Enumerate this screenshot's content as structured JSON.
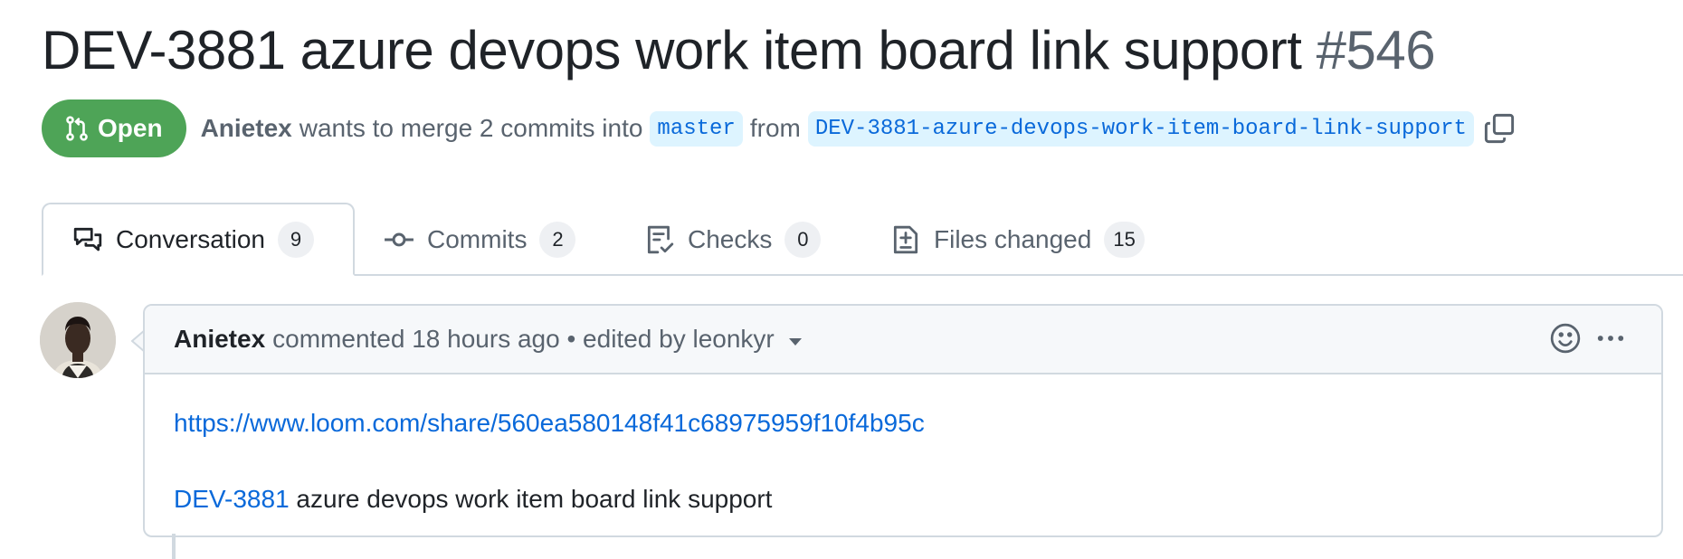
{
  "pr": {
    "title": "DEV-3881 azure devops work item board link support",
    "number": "#546",
    "state": "Open",
    "author": "Anietex",
    "merge_text": "wants to merge 2 commits into",
    "base_branch": "master",
    "from_text": "from",
    "head_branch": "DEV-3881-azure-devops-work-item-board-link-support",
    "state_color": "#4ea457"
  },
  "tabs": [
    {
      "label": "Conversation",
      "count": "9",
      "icon": "comment-discussion-icon"
    },
    {
      "label": "Commits",
      "count": "2",
      "icon": "git-commit-icon"
    },
    {
      "label": "Checks",
      "count": "0",
      "icon": "checklist-icon"
    },
    {
      "label": "Files changed",
      "count": "15",
      "icon": "file-diff-icon"
    }
  ],
  "comment": {
    "author": "Anietex",
    "meta": "commented 18 hours ago • edited by leonkyr",
    "link": "https://www.loom.com/share/560ea580148f41c68975959f10f4b95c",
    "issue_key": "DEV-3881",
    "issue_title": "azure devops work item board link support"
  }
}
